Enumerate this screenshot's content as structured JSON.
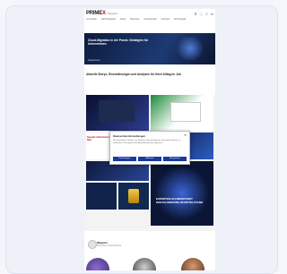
{
  "header": {
    "logo_main": "PRIME",
    "logo_accent": "X",
    "tagline": "Magazin",
    "icons": [
      "search-icon",
      "user-icon",
      "bell-icon",
      "menu-icon"
    ]
  },
  "nav": {
    "items": [
      "Innovation",
      "Nachhaltigkeit",
      "Arbeit",
      "Business",
      "Gesellschaft",
      "Lifestyle",
      "Technologie"
    ]
  },
  "promo": {
    "title": "Cloud-Migration in der Praxis: Strategien für Unternehmen",
    "byline": "Gesponsert"
  },
  "headline": "Aktuelle Storys, Einschätzungen und Analysen für Ihren Alltag im Job",
  "tile_label": "Spezial: Sicherheit im Netz",
  "overlay_tile_title": "EXPERTEN-SCHWERPUNKT DIGITALISIERUNG IM MITTELSTAND",
  "modal": {
    "title": "Datenschutz-Einstellungen",
    "body": "Wir verwenden Cookies, um Inhalte zu personalisieren und unsere Dienste zu verbessern. Sie können Ihre Auswahl jederzeit anpassen.",
    "btn1": "Einstellungen",
    "btn2": "Ablehnen",
    "btn3": "Akzeptieren"
  },
  "section": {
    "title": "Magazin",
    "subtitle": "Menschen & Geschichten"
  }
}
